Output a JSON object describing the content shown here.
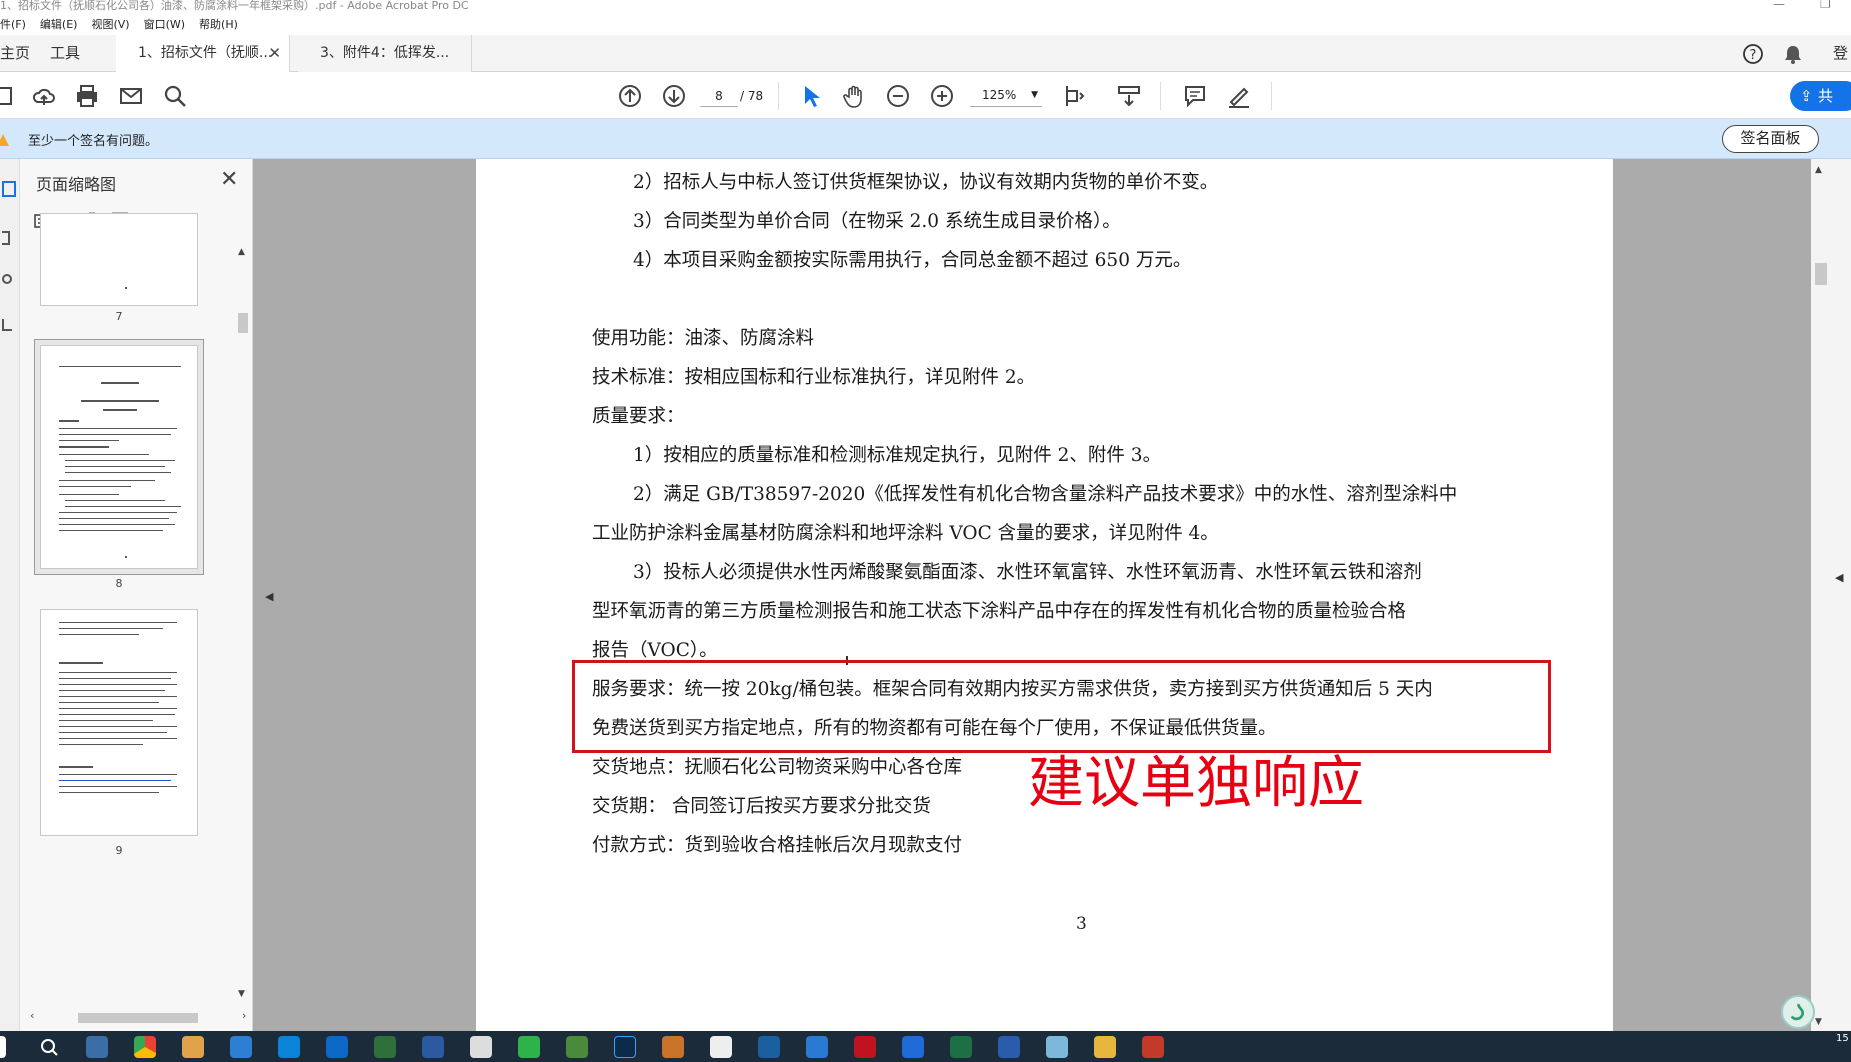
{
  "window": {
    "title": "1、招标文件（抚顺石化公司各）油漆、防腐涂料一年框架采购）.pdf - Adobe Acrobat Pro DC",
    "minimize": "—",
    "restore": "❐"
  },
  "menu": [
    "件(F)",
    "编辑(E)",
    "视图(V)",
    "窗口(W)",
    "帮助(H)"
  ],
  "tabs": {
    "home": "主页",
    "tools": "工具",
    "doc1": "1、招标文件（抚顺...",
    "doc2": "3、附件4：低挥发...",
    "close": "✕",
    "login": "登"
  },
  "toolbar": {
    "page_current": "8",
    "page_total": "/ 78",
    "zoom": "125%",
    "share": "共"
  },
  "signature_bar": {
    "message": "至少一个签名有问题。",
    "panel_button": "签名面板"
  },
  "thumbnails": {
    "title": "页面缩略图",
    "close": "✕",
    "pages": [
      "7",
      "8",
      "9"
    ]
  },
  "document": {
    "lines": [
      "2）招标人与中标人签订供货框架协议，协议有效期内货物的单价不变。",
      "3）合同类型为单价合同（在物采 2.0 系统生成目录价格）。",
      "4）本项目采购金额按实际需用执行，合同总金额不超过 650 万元。",
      "使用功能：油漆、防腐涂料",
      "技术标准：按相应国标和行业标准执行，详见附件 2。",
      "质量要求：",
      "1）按相应的质量标准和检测标准规定执行，见附件 2、附件 3。",
      "2）满足 GB/T38597-2020《低挥发性有机化合物含量涂料产品技术要求》中的水性、溶剂型涂料中",
      "工业防护涂料金属基材防腐涂料和地坪涂料 VOC 含量的要求，详见附件 4。",
      "3）投标人必须提供水性丙烯酸聚氨酯面漆、水性环氧富锌、水性环氧沥青、水性环氧云铁和溶剂",
      "型环氧沥青的第三方质量检测报告和施工状态下涂料产品中存在的挥发性有机化合物的质量检验合格",
      "报告（VOC）。",
      "服务要求：统一按 20kg/桶包装。框架合同有效期内按买方需求供货，卖方接到买方供货通知后 5 天内",
      "免费送货到买方指定地点，所有的物资都有可能在每个厂使用，不保证最低供货量。",
      "交货地点：抚顺石化公司物资采购中心各仓库",
      "交货期：  合同签订后按买方要求分批交货",
      "付款方式：货到验收合格挂帐后次月现款支付"
    ],
    "page_number": "3",
    "annotation": "建议单独响应",
    "annotation_color": "#e60012"
  },
  "taskbar": {
    "clock": "15"
  },
  "colors": {
    "accent": "#1473e6",
    "sigbar": "#d4e8fb",
    "redbox": "#d3111b"
  }
}
